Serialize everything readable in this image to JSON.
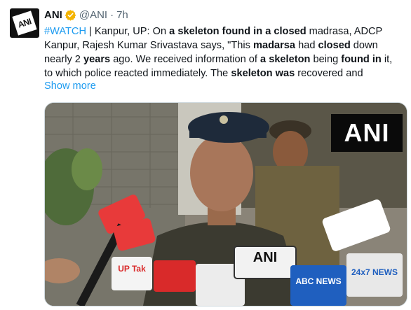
{
  "author": {
    "name": "ANI",
    "handle": "@ANI",
    "separator": "·",
    "time": "7h",
    "avatar_text": "ANI"
  },
  "tweet": {
    "line1": {
      "hashtag": "#WATCH",
      "t1": " | Kanpur, UP: On ",
      "b1": "a skeleton found in a closed",
      "t2": " madrasa, ADCP"
    },
    "line2": {
      "t1": "Kanpur, Rajesh Kumar Srivastava says, \"This ",
      "b1": "madarsa",
      "t2": " had ",
      "b2": "closed",
      "t3": " down"
    },
    "line3": {
      "t1": "nearly 2 ",
      "b1": "years",
      "t2": " ago. We received information of ",
      "b2": "a skeleton",
      "t3": " being ",
      "b3": "found in",
      "t4": " it,"
    },
    "line4": {
      "t1": "to which police reacted immediately. The ",
      "b1": "skeleton was",
      "t2": " recovered and"
    },
    "show_more": "Show more"
  },
  "media": {
    "watermark": "ANI",
    "mic_labels": [
      "ANI",
      "UP Tak",
      "ABC NEWS",
      "24x7 NEWS"
    ]
  },
  "colors": {
    "link": "#1d9bf0",
    "verified": "#f4b400",
    "muted": "#536471"
  }
}
